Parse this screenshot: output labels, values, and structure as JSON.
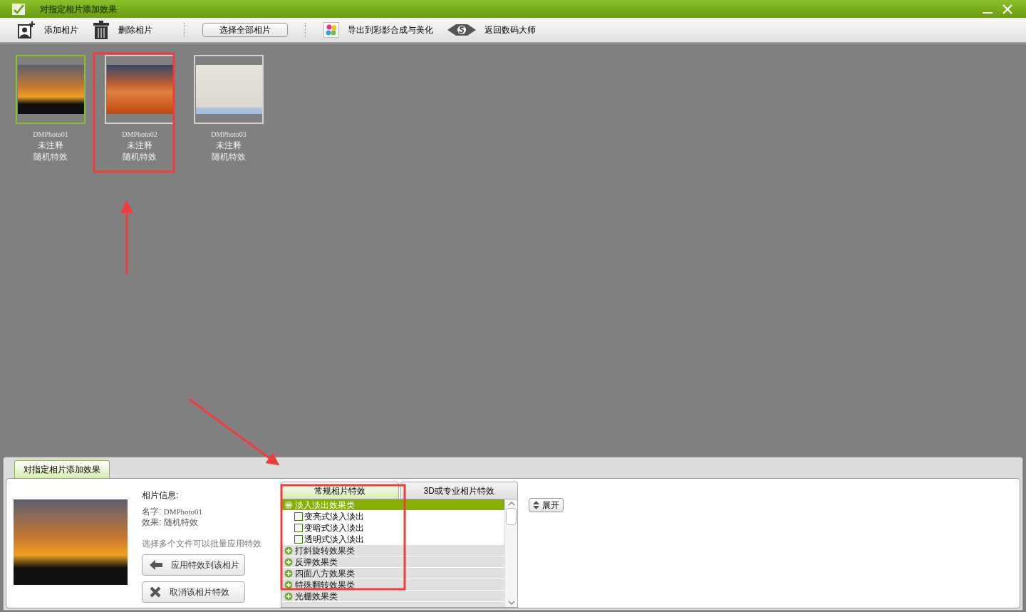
{
  "window": {
    "title": "对指定相片添加效果"
  },
  "toolbar": [
    {
      "kind": "icon",
      "label": "添加相片"
    },
    {
      "kind": "icon",
      "label": "删除相片"
    },
    {
      "kind": "button",
      "label": "选择全部相片"
    },
    {
      "kind": "icon",
      "label": "导出到彩影合成与美化"
    },
    {
      "kind": "icon",
      "label": "返回数码大师"
    }
  ],
  "photos": [
    {
      "name": "DMPhoto01",
      "note": "未注释",
      "effect": "随机特效",
      "selected": true
    },
    {
      "name": "DMPhoto02",
      "note": "未注释",
      "effect": "随机特效",
      "selected": false
    },
    {
      "name": "DMPhoto03",
      "note": "未注释",
      "effect": "随机特效",
      "selected": false
    }
  ],
  "panel": {
    "tab": "对指定相片添加效果",
    "info_title": "相片信息:",
    "name_label": "名字:",
    "name_value": "DMPhoto01",
    "effect_label": "效果:",
    "effect_value": "随机特效",
    "hint": "选择多个文件可以批量应用特效",
    "buttons": [
      {
        "kind": "apply",
        "label": "应用特效到该相片"
      },
      {
        "kind": "cancel",
        "label": "取消该相片特效"
      }
    ],
    "effect_tabs": [
      {
        "label": "常规相片特效",
        "selected": true
      },
      {
        "label": "3D或专业相片特效",
        "selected": false
      }
    ],
    "groups": [
      {
        "label": "淡入淡出效果类",
        "expanded": true,
        "children": [
          {
            "label": "变亮式淡入淡出",
            "checked": false
          },
          {
            "label": "变暗式淡入淡出",
            "checked": false
          },
          {
            "label": "透明式淡入淡出",
            "checked": false
          }
        ]
      },
      {
        "label": "打斜旋转效果类",
        "expanded": false
      },
      {
        "label": "反弹效果类",
        "expanded": false
      },
      {
        "label": "四面八方效果类",
        "expanded": false
      },
      {
        "label": "特殊翻转效果类",
        "expanded": false
      },
      {
        "label": "光栅效果类",
        "expanded": false
      }
    ],
    "expand_button": "展开"
  }
}
